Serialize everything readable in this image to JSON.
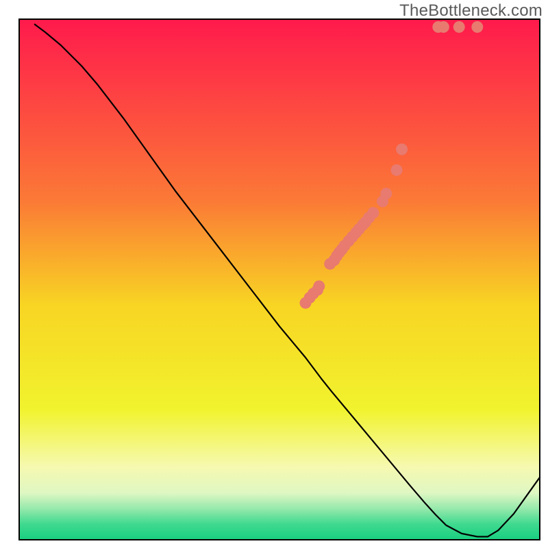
{
  "watermark_text": "TheBottleneck.com",
  "chart_data": {
    "type": "line",
    "title": "",
    "xlabel": "",
    "ylabel": "",
    "xlim": [
      0,
      100
    ],
    "ylim": [
      0,
      100
    ],
    "series": [
      {
        "name": "bottleneck-curve",
        "x": [
          3,
          5,
          8,
          12,
          15,
          20,
          25,
          30,
          35,
          40,
          45,
          50,
          55,
          58,
          60,
          65,
          70,
          75,
          78,
          80,
          82,
          85,
          88,
          90,
          92,
          95,
          100
        ],
        "y": [
          99,
          97.5,
          95,
          91,
          87.5,
          81,
          74,
          67,
          60.5,
          54,
          47.5,
          41,
          35,
          31,
          28.5,
          22.5,
          16.5,
          10.5,
          7,
          4.8,
          2.8,
          1.2,
          0.6,
          0.6,
          1.8,
          5,
          12
        ]
      }
    ],
    "points": {
      "name": "cluster-points",
      "coords": [
        [
          55.0,
          54.5
        ],
        [
          55.8,
          53.5
        ],
        [
          56.5,
          52.7
        ],
        [
          57.3,
          52.0
        ],
        [
          57.6,
          51.3
        ],
        [
          59.7,
          47.0
        ],
        [
          60.5,
          46.3
        ],
        [
          61.0,
          45.5
        ],
        [
          61.5,
          44.8
        ],
        [
          62.0,
          44.2
        ],
        [
          62.5,
          43.5
        ],
        [
          63.3,
          42.6
        ],
        [
          64.0,
          41.8
        ],
        [
          64.7,
          41.0
        ],
        [
          65.3,
          40.3
        ],
        [
          66.0,
          39.5
        ],
        [
          66.5,
          39.0
        ],
        [
          67.2,
          38.1
        ],
        [
          68.0,
          37.2
        ],
        [
          69.8,
          35.0
        ],
        [
          70.5,
          33.5
        ],
        [
          72.5,
          29.0
        ],
        [
          73.5,
          25.0
        ],
        [
          80.5,
          1.5
        ],
        [
          81.5,
          1.5
        ],
        [
          84.5,
          1.5
        ],
        [
          88.0,
          1.5
        ]
      ]
    },
    "bg_gradient_stops": [
      {
        "offset": 0,
        "color": "#ff1a4c"
      },
      {
        "offset": 35,
        "color": "#fb7a36"
      },
      {
        "offset": 55,
        "color": "#f8d523"
      },
      {
        "offset": 75,
        "color": "#f1f32e"
      },
      {
        "offset": 86,
        "color": "#f6f9b0"
      },
      {
        "offset": 91,
        "color": "#dff7c3"
      },
      {
        "offset": 94,
        "color": "#96e9ac"
      },
      {
        "offset": 97,
        "color": "#3fd98f"
      },
      {
        "offset": 100,
        "color": "#19cf80"
      }
    ],
    "plot_rect_pct": {
      "x": 3.5,
      "y": 3.5,
      "w": 95,
      "h": 95
    },
    "point_radius_px": 8.5
  }
}
